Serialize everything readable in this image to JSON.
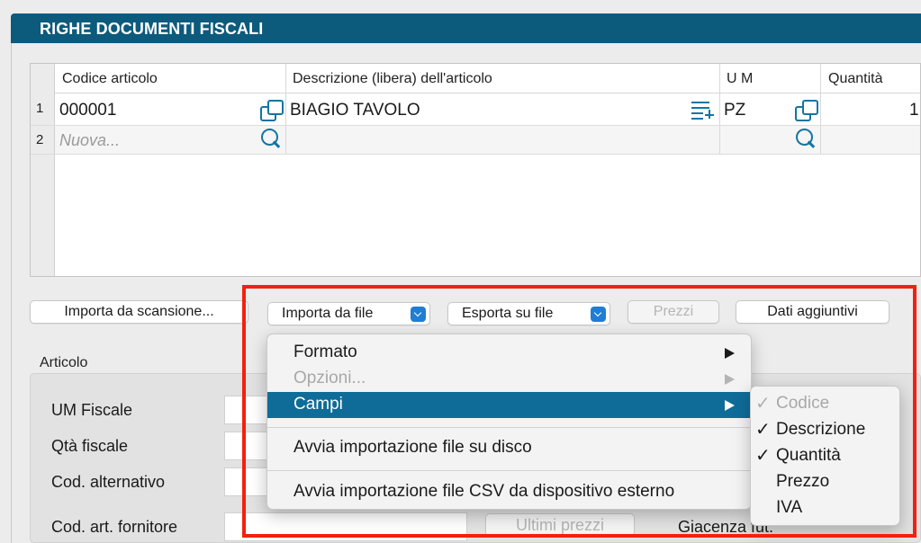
{
  "window": {
    "title": "RIGHE DOCUMENTI FISCALI"
  },
  "grid": {
    "columns": [
      "Codice articolo",
      "Descrizione (libera) dell'articolo",
      "U M",
      "Quantità"
    ],
    "rows": [
      {
        "num": "1",
        "code": "000001",
        "description": "BIAGIO TAVOLO",
        "um": "PZ",
        "qty": "1"
      },
      {
        "num": "2",
        "code_placeholder": "Nuova..."
      }
    ]
  },
  "toolbar": {
    "import_scan": "Importa da scansione...",
    "import_file": "Importa da file",
    "export_file": "Esporta su file",
    "prices": "Prezzi",
    "extra_data": "Dati aggiuntivi"
  },
  "articolo": {
    "section": "Articolo",
    "um_fiscale": "UM Fiscale",
    "qta_fiscale": "Qtà fiscale",
    "cod_alternativo": "Cod. alternativo",
    "cod_art_fornitore": "Cod. art. fornitore",
    "ultimi_prezzi": "Ultimi prezzi",
    "giacenza": "Giacenza fut."
  },
  "menu": {
    "formato": "Formato",
    "opzioni": "Opzioni...",
    "campi": "Campi",
    "avvia_disco": "Avvia importazione file su disco",
    "avvia_csv": "Avvia importazione file CSV da dispositivo esterno"
  },
  "submenu": {
    "items": [
      {
        "label": "Codice",
        "check": "✓"
      },
      {
        "label": "Descrizione",
        "check": "✓"
      },
      {
        "label": "Quantità",
        "check": "✓"
      },
      {
        "label": "Prezzo",
        "check": ""
      },
      {
        "label": "IVA",
        "check": ""
      }
    ]
  },
  "colors": {
    "title_bar": "#0c5a7c",
    "icon": "#1374a3",
    "menu_selected": "#0f6c98",
    "highlight_box": "#f2210f"
  }
}
